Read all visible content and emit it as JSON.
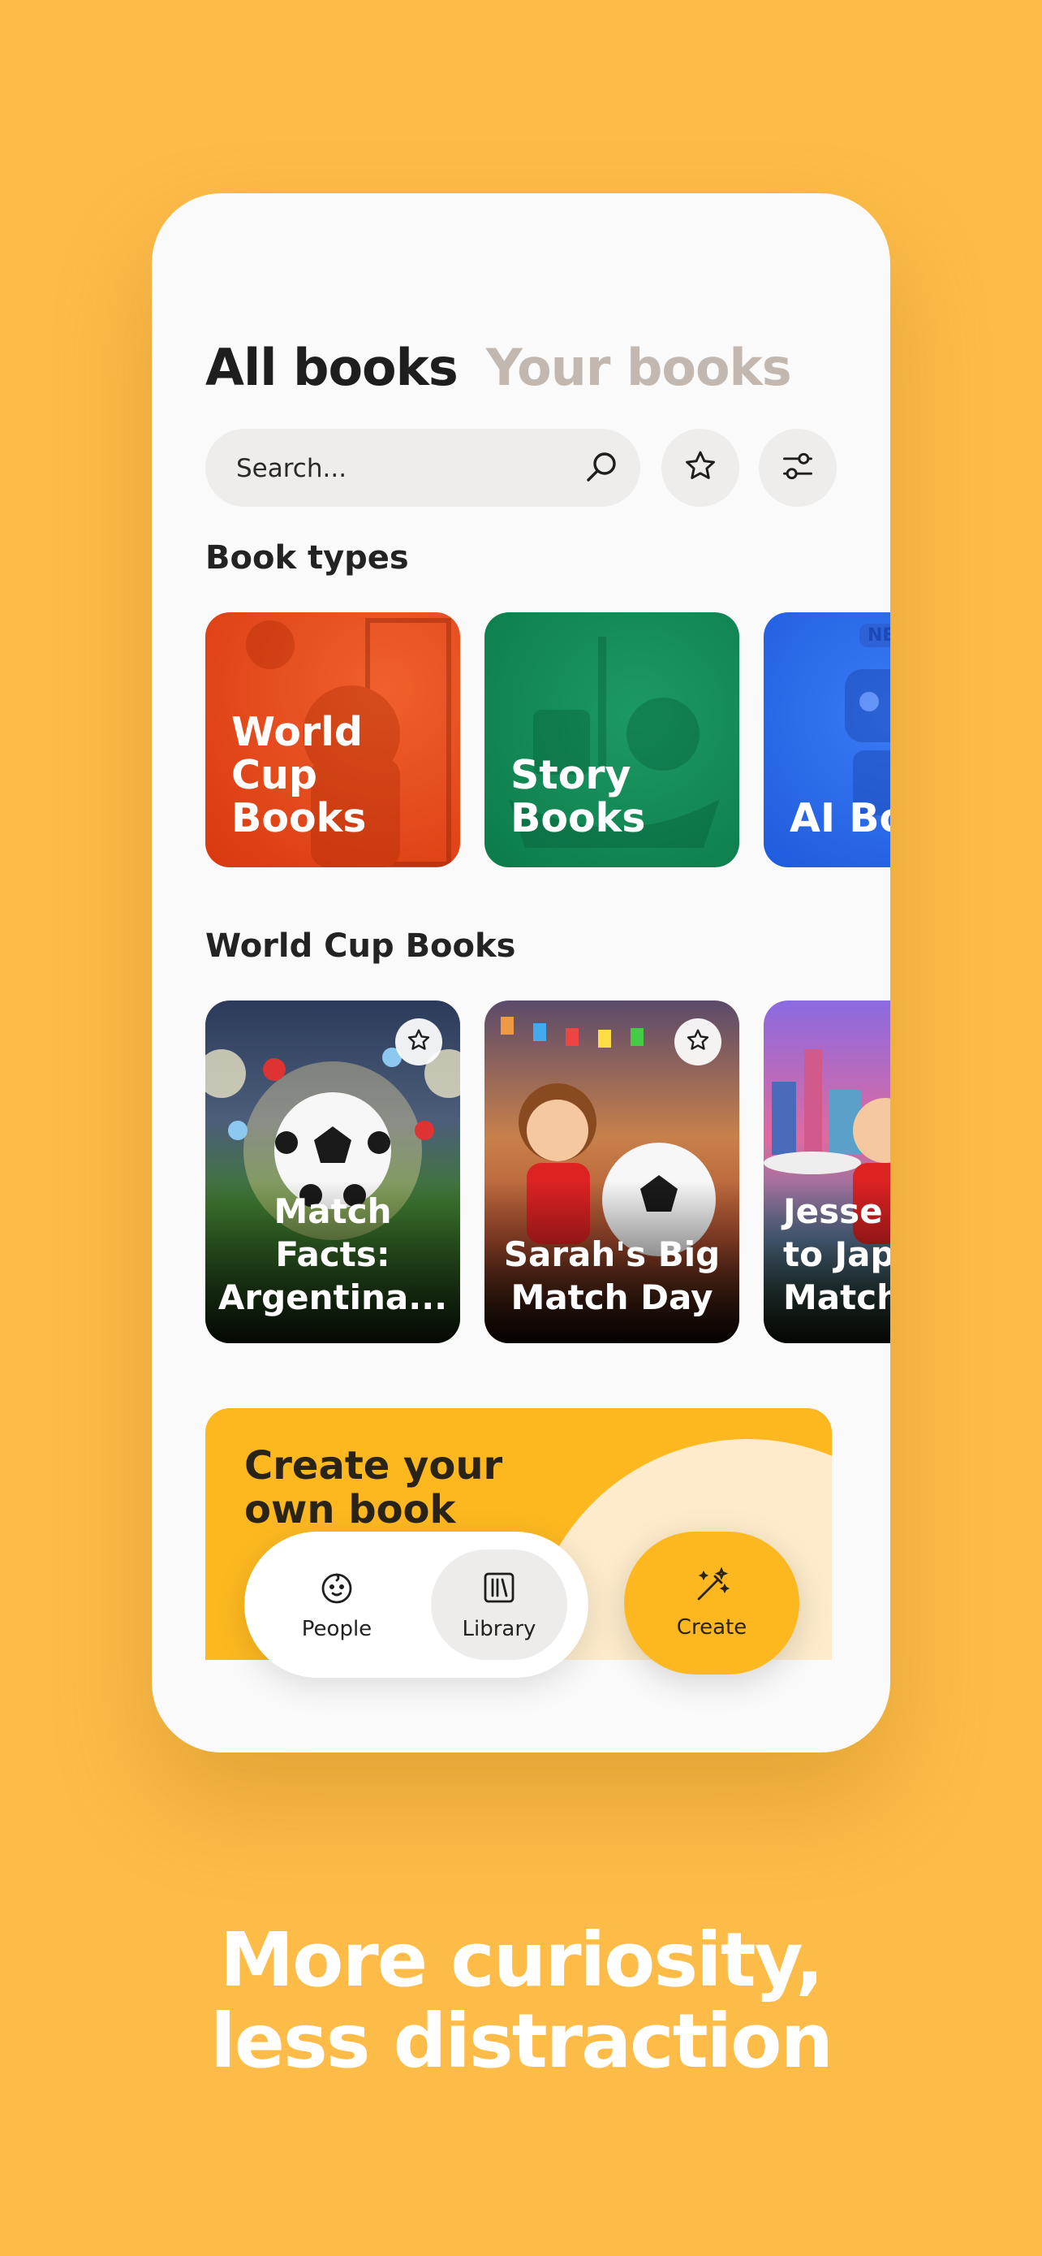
{
  "tabs": {
    "all_books": "All books",
    "your_books": "Your books"
  },
  "search": {
    "placeholder": "Search..."
  },
  "icons": {
    "search": "search-icon",
    "favorites": "star-icon",
    "filters": "filter-sliders-icon"
  },
  "book_types": {
    "title": "Book types",
    "items": [
      {
        "label": "World\nCup\nBooks",
        "color": "#E8471B"
      },
      {
        "label": "Story\nBooks",
        "color": "#0F8A55"
      },
      {
        "label": "AI Bo",
        "badge": "NE",
        "color": "#2E6CE8"
      }
    ]
  },
  "world_cup": {
    "title": "World Cup Books",
    "items": [
      {
        "label": "Match\nFacts:\nArgentina...",
        "favorite": false
      },
      {
        "label": "Sarah's Big\nMatch Day",
        "favorite": false
      },
      {
        "label": "Jesse\nto Jap\nMatch",
        "favorite": false
      }
    ]
  },
  "banner": {
    "title": "Create your\nown book"
  },
  "nav": {
    "people": "People",
    "library": "Library",
    "create": "Create",
    "selected": "Library"
  },
  "tagline": "More curiosity,\nless distraction",
  "colors": {
    "background": "#FDBC48",
    "accent": "#FDB820",
    "inactive_tab": "#C2B8B0"
  }
}
